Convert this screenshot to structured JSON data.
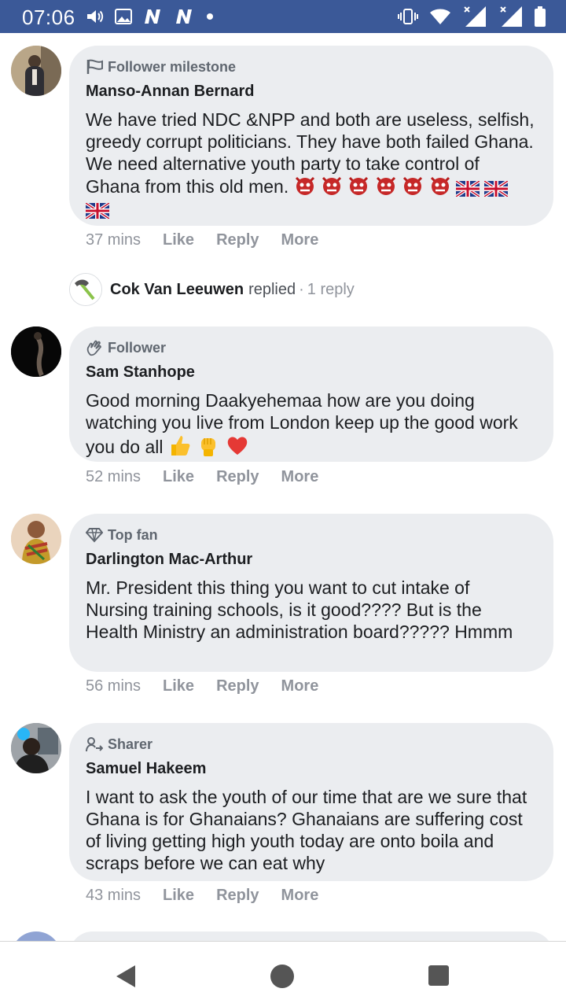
{
  "status_bar": {
    "time": "07:06",
    "left_icons": [
      "volume-icon",
      "image-icon",
      "n-icon",
      "n-icon",
      "dot-icon"
    ],
    "right_icons": [
      "vibrate-icon",
      "wifi-icon",
      "signal-icon",
      "signal-icon",
      "battery-icon"
    ]
  },
  "comments": [
    {
      "badge": "Follower milestone",
      "badge_icon": "flag-icon",
      "author": "Manso-Annan Bernard",
      "text": "We have tried NDC &NPP and both are useless, selfish, greedy corrupt politicians. They have both failed Ghana. We need alternative youth party to take control of Ghana from this old men.",
      "time": "37 mins",
      "like": "Like",
      "reply": "Reply",
      "more": "More"
    },
    {
      "badge": "Follower",
      "badge_icon": "wave-icon",
      "author": "Sam Stanhope",
      "text": "Good morning Daakyehemaa how are you doing watching you live from London keep up the good work you do all",
      "time": "52 mins",
      "like": "Like",
      "reply": "Reply",
      "more": "More"
    },
    {
      "badge": "Top fan",
      "badge_icon": "diamond-icon",
      "author": "Darlington Mac-Arthur",
      "text": "Mr. President this thing you want to cut intake of Nursing training schools, is it good???? But is the Health Ministry an administration board????? Hmmm",
      "time": "56 mins",
      "like": "Like",
      "reply": "Reply",
      "more": "More"
    },
    {
      "badge": "Sharer",
      "badge_icon": "share-person-icon",
      "author": "Samuel Hakeem",
      "text": "I want to ask the youth of our time that are we sure that Ghana is for Ghanaians? Ghanaians are suffering cost of living getting high youth today are onto boila and scraps before we can eat why",
      "time": "43 mins",
      "like": "Like",
      "reply": "Reply",
      "more": "More"
    }
  ],
  "reply_thread": {
    "name": "Cok Van Leeuwen",
    "replied": "replied",
    "separator": "·",
    "count": "1 reply"
  },
  "colors": {
    "status_bar": "#3b5998",
    "bubble": "#ebedf0",
    "muted_text": "#90949c"
  },
  "nav_bar": {
    "icons": [
      "back-icon",
      "home-icon",
      "recents-icon"
    ]
  }
}
